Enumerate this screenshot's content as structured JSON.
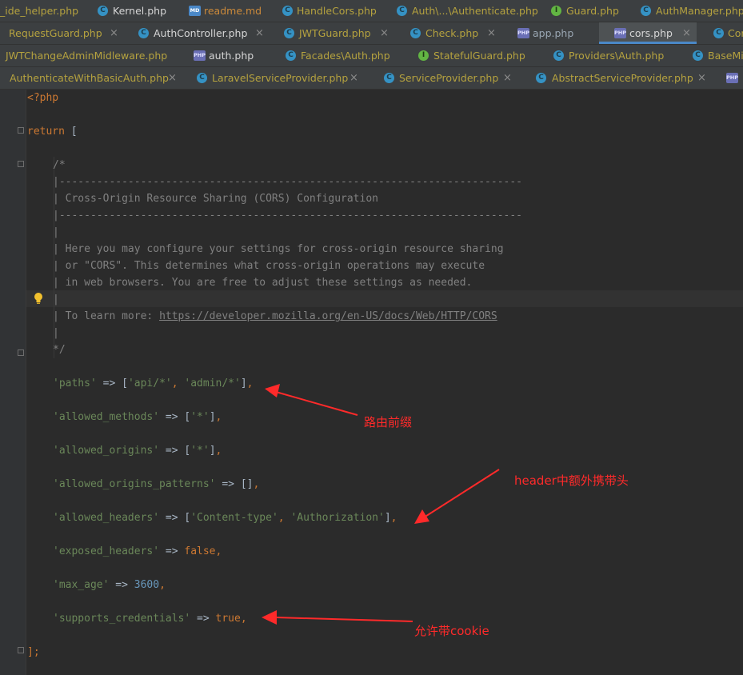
{
  "tabs": {
    "row1": [
      {
        "label": "_ide_helper.php",
        "icon": "php-file-icon",
        "color": "yellow"
      },
      {
        "label": "Kernel.php",
        "icon": "class-icon",
        "color": "plain"
      },
      {
        "label": "readme.md",
        "icon": "markdown-file-icon",
        "color": "orange"
      },
      {
        "label": "HandleCors.php",
        "icon": "class-icon",
        "color": "yellow"
      },
      {
        "label": "Auth\\...\\Authenticate.php",
        "icon": "class-icon",
        "color": "yellow"
      },
      {
        "label": "Guard.php",
        "icon": "interface-icon",
        "color": "yellow"
      },
      {
        "label": "AuthManager.php",
        "icon": "class-icon",
        "color": "yellow"
      }
    ],
    "row2": [
      {
        "label": "RequestGuard.php",
        "icon": "class-icon",
        "color": "yellow"
      },
      {
        "label": "AuthController.php",
        "icon": "class-icon",
        "color": "plain"
      },
      {
        "label": "JWTGuard.php",
        "icon": "class-icon",
        "color": "yellow"
      },
      {
        "label": "Check.php",
        "icon": "class-icon",
        "color": "yellow"
      },
      {
        "label": "app.php",
        "icon": "php-file-icon",
        "color": "blue"
      },
      {
        "label": "cors.php",
        "icon": "php-file-icon",
        "color": "plain",
        "active": true
      },
      {
        "label": "Cor",
        "icon": "class-icon",
        "color": "yellow"
      }
    ],
    "row3": [
      {
        "label": "JWTChangeAdminMidleware.php",
        "icon": "class-icon",
        "color": "yellow"
      },
      {
        "label": "auth.php",
        "icon": "php-file-icon",
        "color": "plain"
      },
      {
        "label": "Facades\\Auth.php",
        "icon": "class-icon",
        "color": "yellow"
      },
      {
        "label": "StatefulGuard.php",
        "icon": "interface-icon",
        "color": "yellow"
      },
      {
        "label": "Providers\\Auth.php",
        "icon": "class-icon",
        "color": "yellow"
      },
      {
        "label": "BaseMi",
        "icon": "class-icon",
        "color": "yellow"
      }
    ],
    "row4": [
      {
        "label": "AuthenticateWithBasicAuth.php",
        "icon": "class-icon",
        "color": "yellow"
      },
      {
        "label": "LaravelServiceProvider.php",
        "icon": "class-icon",
        "color": "yellow"
      },
      {
        "label": "ServiceProvider.php",
        "icon": "class-icon",
        "color": "yellow"
      },
      {
        "label": "AbstractServiceProvider.php",
        "icon": "class-icon",
        "color": "yellow"
      },
      {
        "label": "",
        "icon": "php-file-icon",
        "color": "plain"
      }
    ]
  },
  "code": {
    "php_open": "<?php",
    "return_kw": "return",
    "open_bracket": " [",
    "comment": [
      "/*",
      "|--------------------------------------------------------------------------",
      "| Cross-Origin Resource Sharing (CORS) Configuration",
      "|--------------------------------------------------------------------------",
      "|",
      "| Here you may configure your settings for cross-origin resource sharing",
      "| or \"CORS\". This determines what cross-origin operations may execute",
      "| in web browsers. You are free to adjust these settings as needed.",
      "|",
      "| To learn more: ",
      "|",
      "*/"
    ],
    "doc_link": "https://developer.mozilla.org/en-US/docs/Web/HTTP/CORS",
    "paths_key": "'paths'",
    "paths_v1": "'api/*'",
    "paths_v2": "'admin/*'",
    "methods_key": "'allowed_methods'",
    "methods_v": "'*'",
    "origins_key": "'allowed_origins'",
    "origins_v": "'*'",
    "patterns_key": "'allowed_origins_patterns'",
    "headers_key": "'allowed_headers'",
    "headers_v1": "'Content-type'",
    "headers_v2": "'Authorization'",
    "exposed_key": "'exposed_headers'",
    "exposed_v": "false",
    "maxage_key": "'max_age'",
    "maxage_v": "3600",
    "creds_key": "'supports_credentials'",
    "creds_v": "true",
    "close": "];",
    "arrow": " => ",
    "empty_array": "[]"
  },
  "annotations": {
    "route_prefix": "路由前缀",
    "header_extra": "header中额外携带头",
    "allow_cookie": "允许带cookie",
    "color": "#ff2a2a"
  }
}
